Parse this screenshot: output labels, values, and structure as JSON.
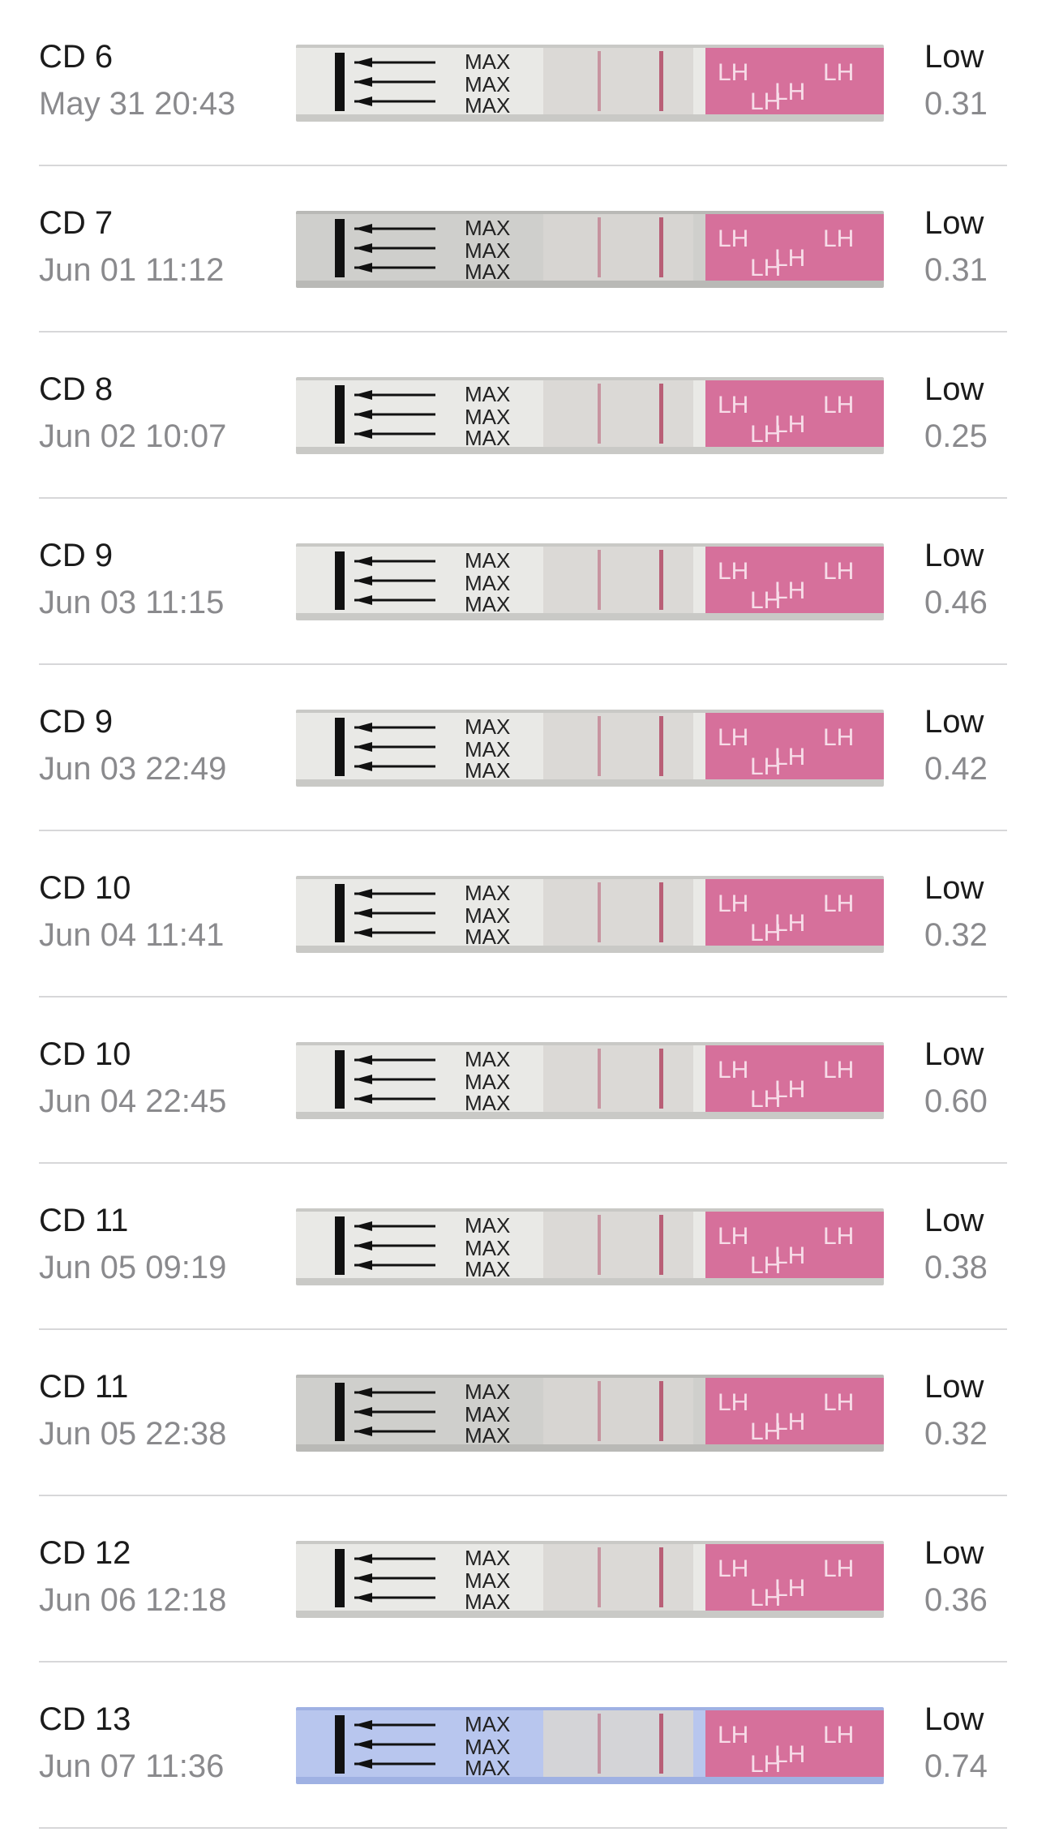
{
  "entries": [
    {
      "cd": "CD 6",
      "date": "May 31 20:43",
      "level": "Low",
      "value": "0.31",
      "strip_tint": "neutral"
    },
    {
      "cd": "CD 7",
      "date": "Jun 01 11:12",
      "level": "Low",
      "value": "0.31",
      "strip_tint": "gray"
    },
    {
      "cd": "CD 8",
      "date": "Jun 02 10:07",
      "level": "Low",
      "value": "0.25",
      "strip_tint": "neutral"
    },
    {
      "cd": "CD 9",
      "date": "Jun 03 11:15",
      "level": "Low",
      "value": "0.46",
      "strip_tint": "neutral"
    },
    {
      "cd": "CD 9",
      "date": "Jun 03 22:49",
      "level": "Low",
      "value": "0.42",
      "strip_tint": "neutral"
    },
    {
      "cd": "CD 10",
      "date": "Jun 04 11:41",
      "level": "Low",
      "value": "0.32",
      "strip_tint": "neutral"
    },
    {
      "cd": "CD 10",
      "date": "Jun 04 22:45",
      "level": "Low",
      "value": "0.60",
      "strip_tint": "neutral"
    },
    {
      "cd": "CD 11",
      "date": "Jun 05 09:19",
      "level": "Low",
      "value": "0.38",
      "strip_tint": "neutral"
    },
    {
      "cd": "CD 11",
      "date": "Jun 05 22:38",
      "level": "Low",
      "value": "0.32",
      "strip_tint": "gray"
    },
    {
      "cd": "CD 12",
      "date": "Jun 06 12:18",
      "level": "Low",
      "value": "0.36",
      "strip_tint": "neutral"
    },
    {
      "cd": "CD 13",
      "date": "Jun 07 11:36",
      "level": "Low",
      "value": "0.74",
      "strip_tint": "blue"
    }
  ],
  "strip": {
    "max_text": "MAX",
    "lh_text": "LH"
  },
  "colors": {
    "separator": "#d7d7d9",
    "primary_text": "#1b1b1b",
    "secondary_text": "#8a8a8d",
    "pink": "#d6709b",
    "test_line": "#b0405f"
  }
}
